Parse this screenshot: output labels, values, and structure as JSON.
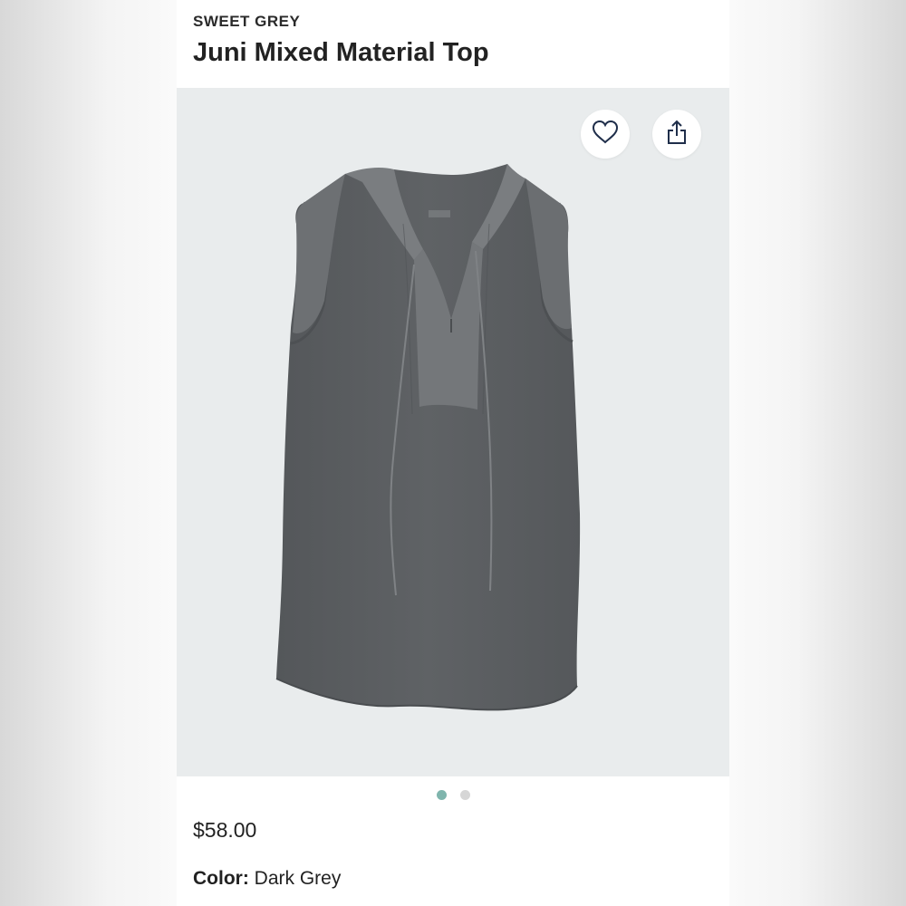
{
  "product": {
    "brand": "SWEET GREY",
    "name": "Juni Mixed Material Top",
    "price": "$58.00",
    "color_label": "Color:",
    "color_value": "Dark Grey"
  },
  "hero": {
    "background": "#e9eced",
    "garment_color": "#5b5e61",
    "satin_trim_color": "#74777a",
    "favorite_icon": "heart-icon",
    "share_icon": "share-icon"
  },
  "carousel": {
    "image_count": 2,
    "active_index": 0,
    "active_color": "#7fb5ad",
    "inactive_color": "#d6d6d6"
  }
}
